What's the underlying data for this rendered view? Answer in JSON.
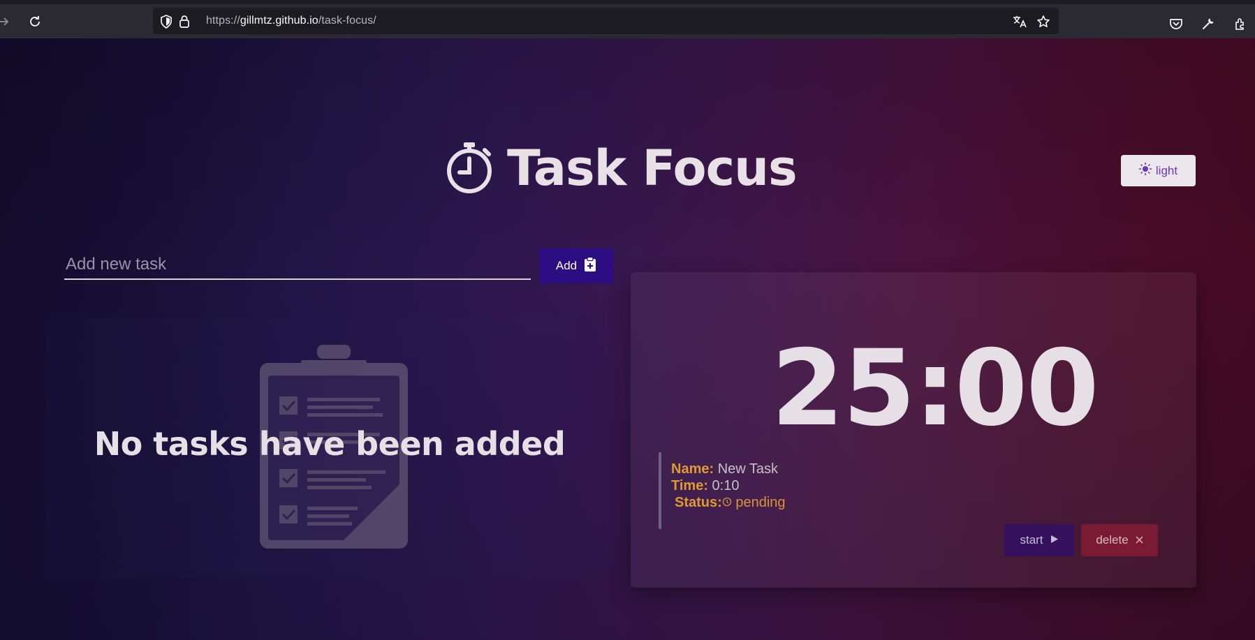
{
  "browser": {
    "url_prefix": "https://",
    "url_host": "gillmtz.github.io",
    "url_path": "/task-focus/"
  },
  "app": {
    "title": "Task Focus",
    "theme_toggle_label": "light",
    "accent_color": "#2c0d82"
  },
  "task_form": {
    "placeholder": "Add new task",
    "value": "",
    "add_label": "Add"
  },
  "task_list": {
    "empty_message": "No tasks have been added"
  },
  "timer": {
    "display": "25:00",
    "task": {
      "name_key": "Name:",
      "name": "New Task",
      "time_key": "Time:",
      "time": "0:10",
      "status_key": "Status:",
      "status": "pending"
    },
    "start_label": "start",
    "delete_label": "delete"
  }
}
